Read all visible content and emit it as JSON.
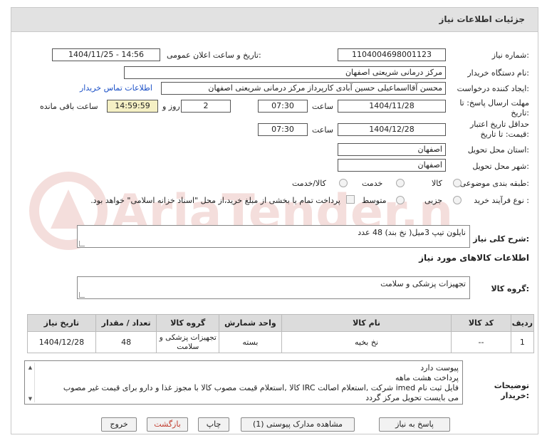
{
  "header": {
    "title": "جزئیات اطلاعات نیاز"
  },
  "fields": {
    "need_number_label": "شماره نیاز:",
    "need_number": "1104004698001123",
    "announce_label": "تاریخ و ساعت اعلان عمومی:",
    "announce_value": "1404/11/25 - 14:56",
    "buyer_org_label": "نام دستگاه خریدار:",
    "buyer_org": "مرکز درمانی شریعتی اصفهان",
    "requester_label": "ایجاد کننده درخواست:",
    "requester": "محسن آقااسماعیلی حسین آبادی کارپرداز مرکز درمانی شریعتی اصفهان",
    "contact_link": "اطلاعات تماس خریدار",
    "deadline_label_1": "مهلت ارسال پاسخ: تا",
    "deadline_label_2": "تاریخ:",
    "deadline_date": "1404/11/28",
    "time_label": "ساعت",
    "deadline_time": "07:30",
    "days_value": "2",
    "days_label": "روز و",
    "remaining_time": "14:59:59",
    "remaining_label": "ساعت باقی مانده",
    "validity_label_1": "حداقل تاریخ اعتبار",
    "validity_label_2": "قیمت: تا تاریخ:",
    "validity_date": "1404/12/28",
    "validity_time": "07:30",
    "province_label": "استان محل تحویل:",
    "province": "اصفهان",
    "city_label": "شهر محل تحویل:",
    "city": "اصفهان",
    "category_label": "طبقه بندی موضوعی:",
    "category_options": [
      "کالا",
      "خدمت",
      "کالا/خدمت"
    ],
    "process_label": "نوع فرآیند خرید :",
    "process_options": [
      "جزیی",
      "متوسط"
    ],
    "payment_note": "پرداخت تمام یا بخشی از مبلغ خرید،از محل \"اسناد خزانه اسلامی\" خواهد بود."
  },
  "description": {
    "label": "شرح کلی نیاز:",
    "text": "نایلون تیپ 3میل( نخ بند) 48 عدد"
  },
  "goods_section": {
    "title": "اطلاعات کالاهای مورد نیاز",
    "group_label": "گروه کالا:",
    "group_value": "تجهیزات پزشکی و سلامت"
  },
  "table": {
    "headers": [
      "ردیف",
      "کد کالا",
      "نام کالا",
      "واحد شمارش",
      "گروه کالا",
      "تعداد / مقدار",
      "تاریخ نیاز"
    ],
    "rows": [
      [
        "1",
        "--",
        "نخ بخیه",
        "بسته",
        "تجهیزات پزشکی و سلامت",
        "48",
        "1404/12/28"
      ]
    ]
  },
  "buyer_notes": {
    "label_1": "توضیحات",
    "label_2": "خریدار:",
    "lines": [
      "پیوست دارد",
      "پرداخت هشت ماهه",
      "فایل ثبت نام imed شرکت ,استعلام اصالت IRC کالا ,استعلام قیمت مصوب کالا با مجوز غذا و دارو برای قیمت غیر مصوب",
      "می بایست تحویل مرکز گردد"
    ]
  },
  "buttons": {
    "reply": "پاسخ به نیاز",
    "attachments": "مشاهده مدارک پیوستی (1)",
    "print": "چاپ",
    "back": "بازگشت",
    "exit": "خروج"
  },
  "watermark": {
    "text": "AriaTender.neT"
  },
  "colors": {
    "title_bar": "#e2e2e2",
    "highlight": "#f5f0c4",
    "link": "#1a4fc6",
    "watermark": "#c0392b"
  }
}
